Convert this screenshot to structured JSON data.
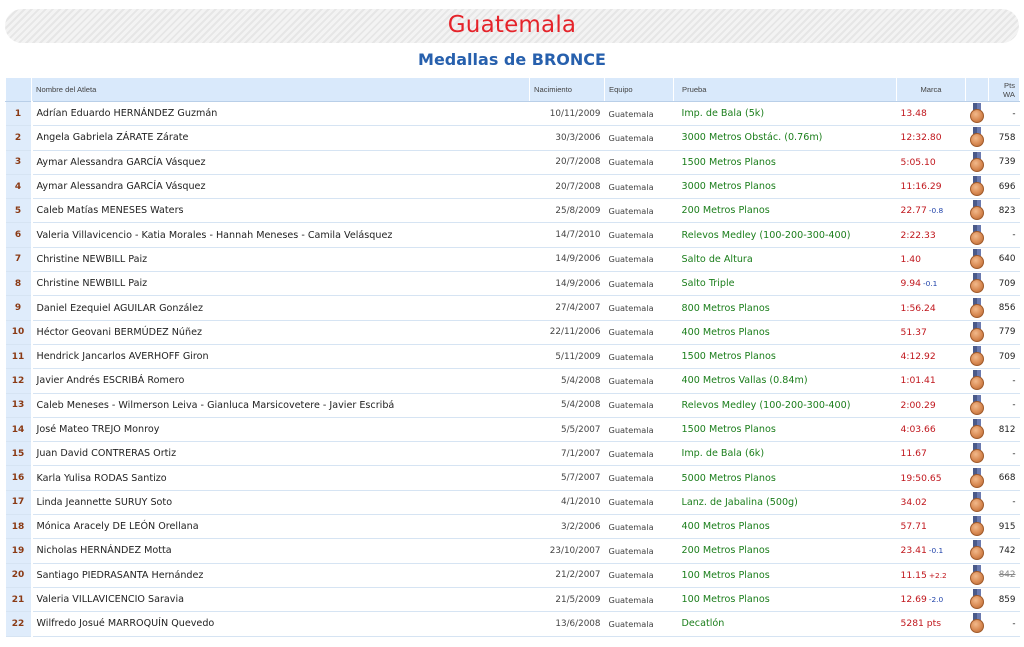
{
  "header": {
    "country": "Guatemala",
    "subtitle": "Medallas de BRONCE"
  },
  "table": {
    "columns": {
      "num": "",
      "name": "Nombre del Atleta",
      "birth": "Nacimiento",
      "team": "Equipo",
      "event": "Prueba",
      "mark": "Marca",
      "medal": "",
      "pts_line1": "Pts",
      "pts_line2": "WA"
    },
    "medal_icon": "bronze-medal-icon",
    "colors": {
      "header_bg": "#d9e9fb",
      "event": "#1b7e1b",
      "mark": "#c0161c",
      "num": "#8a3a14"
    },
    "rows": [
      {
        "num": "1",
        "name": "Adrían Eduardo HERNÁNDEZ Guzmán",
        "birth": "10/11/2009",
        "team": "Guatemala",
        "event": "Imp. de Bala (5k)",
        "mark": "13.48",
        "wind": "",
        "pts": "-"
      },
      {
        "num": "2",
        "name": "Angela Gabriela ZÁRATE Zárate",
        "birth": "30/3/2006",
        "team": "Guatemala",
        "event": "3000 Metros Obstác. (0.76m)",
        "mark": "12:32.80",
        "wind": "",
        "pts": "758"
      },
      {
        "num": "3",
        "name": "Aymar Alessandra GARCÍA Vásquez",
        "birth": "20/7/2008",
        "team": "Guatemala",
        "event": "1500 Metros Planos",
        "mark": "5:05.10",
        "wind": "",
        "pts": "739"
      },
      {
        "num": "4",
        "name": "Aymar Alessandra GARCÍA Vásquez",
        "birth": "20/7/2008",
        "team": "Guatemala",
        "event": "3000 Metros Planos",
        "mark": "11:16.29",
        "wind": "",
        "pts": "696"
      },
      {
        "num": "5",
        "name": "Caleb Matías MENESES Waters",
        "birth": "25/8/2009",
        "team": "Guatemala",
        "event": "200 Metros Planos",
        "mark": "22.77",
        "wind": "-0.8",
        "pts": "823"
      },
      {
        "num": "6",
        "name": "Valeria Villavicencio - Katia Morales - Hannah Meneses - Camila Velásquez",
        "birth": "14/7/2010",
        "team": "Guatemala",
        "event": "Relevos Medley (100-200-300-400)",
        "mark": "2:22.33",
        "wind": "",
        "pts": "-"
      },
      {
        "num": "7",
        "name": "Christine NEWBILL Paiz",
        "birth": "14/9/2006",
        "team": "Guatemala",
        "event": "Salto de Altura",
        "mark": "1.40",
        "wind": "",
        "pts": "640"
      },
      {
        "num": "8",
        "name": "Christine NEWBILL Paiz",
        "birth": "14/9/2006",
        "team": "Guatemala",
        "event": "Salto Triple",
        "mark": "9.94",
        "wind": "-0.1",
        "pts": "709"
      },
      {
        "num": "9",
        "name": "Daniel Ezequiel AGUILAR González",
        "birth": "27/4/2007",
        "team": "Guatemala",
        "event": "800 Metros Planos",
        "mark": "1:56.24",
        "wind": "",
        "pts": "856"
      },
      {
        "num": "10",
        "name": "Héctor Geovani BERMÚDEZ Núñez",
        "birth": "22/11/2006",
        "team": "Guatemala",
        "event": "400 Metros Planos",
        "mark": "51.37",
        "wind": "",
        "pts": "779"
      },
      {
        "num": "11",
        "name": "Hendrick Jancarlos AVERHOFF Giron",
        "birth": "5/11/2009",
        "team": "Guatemala",
        "event": "1500 Metros Planos",
        "mark": "4:12.92",
        "wind": "",
        "pts": "709"
      },
      {
        "num": "12",
        "name": "Javier Andrés ESCRIBÁ Romero",
        "birth": "5/4/2008",
        "team": "Guatemala",
        "event": "400 Metros Vallas (0.84m)",
        "mark": "1:01.41",
        "wind": "",
        "pts": "-"
      },
      {
        "num": "13",
        "name": "Caleb Meneses - Wilmerson Leiva - Gianluca Marsicovetere - Javier Escribá",
        "birth": "5/4/2008",
        "team": "Guatemala",
        "event": "Relevos Medley (100-200-300-400)",
        "mark": "2:00.29",
        "wind": "",
        "pts": "-"
      },
      {
        "num": "14",
        "name": "José Mateo TREJO Monroy",
        "birth": "5/5/2007",
        "team": "Guatemala",
        "event": "1500 Metros Planos",
        "mark": "4:03.66",
        "wind": "",
        "pts": "812"
      },
      {
        "num": "15",
        "name": "Juan David CONTRERAS Ortiz",
        "birth": "7/1/2007",
        "team": "Guatemala",
        "event": "Imp. de Bala (6k)",
        "mark": "11.67",
        "wind": "",
        "pts": "-"
      },
      {
        "num": "16",
        "name": "Karla Yulisa RODAS Santizo",
        "birth": "5/7/2007",
        "team": "Guatemala",
        "event": "5000 Metros Planos",
        "mark": "19:50.65",
        "wind": "",
        "pts": "668"
      },
      {
        "num": "17",
        "name": "Linda Jeannette SURUY Soto",
        "birth": "4/1/2010",
        "team": "Guatemala",
        "event": "Lanz. de Jabalina (500g)",
        "mark": "34.02",
        "wind": "",
        "pts": "-"
      },
      {
        "num": "18",
        "name": "Mónica Aracely DE LEÓN Orellana",
        "birth": "3/2/2006",
        "team": "Guatemala",
        "event": "400 Metros Planos",
        "mark": "57.71",
        "wind": "",
        "pts": "915"
      },
      {
        "num": "19",
        "name": "Nicholas HERNÁNDEZ Motta",
        "birth": "23/10/2007",
        "team": "Guatemala",
        "event": "200 Metros Planos",
        "mark": "23.41",
        "wind": "-0.1",
        "pts": "742"
      },
      {
        "num": "20",
        "name": "Santiago PIEDRASANTA Hernández",
        "birth": "21/2/2007",
        "team": "Guatemala",
        "event": "100 Metros Planos",
        "mark": "11.15",
        "wind": "+2.2",
        "pts": "842",
        "pts_struck": true
      },
      {
        "num": "21",
        "name": "Valeria VILLAVICENCIO Saravia",
        "birth": "21/5/2009",
        "team": "Guatemala",
        "event": "100 Metros Planos",
        "mark": "12.69",
        "wind": "-2.0",
        "pts": "859"
      },
      {
        "num": "22",
        "name": "Wilfredo Josué MARROQUÍN Quevedo",
        "birth": "13/6/2008",
        "team": "Guatemala",
        "event": "Decatlón",
        "mark": "5281 pts",
        "wind": "",
        "pts": "-"
      }
    ]
  }
}
